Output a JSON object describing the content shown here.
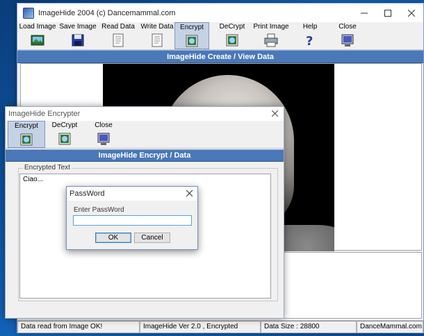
{
  "main_window": {
    "title": "ImageHide 2004 (c) Dancemammal.com",
    "toolbar": [
      {
        "label": "Load Image",
        "icon": "load-image-icon"
      },
      {
        "label": "Save Image",
        "icon": "save-image-icon"
      },
      {
        "label": "Read Data",
        "icon": "read-data-icon"
      },
      {
        "label": "Write Data",
        "icon": "write-data-icon"
      },
      {
        "label": "Encrypt",
        "icon": "encrypt-icon",
        "pressed": true
      },
      {
        "label": "DeCrypt",
        "icon": "decrypt-icon"
      },
      {
        "label": "Print Image",
        "icon": "print-icon"
      },
      {
        "label": "Help",
        "icon": "help-icon"
      },
      {
        "label": "Close",
        "icon": "close-icon"
      }
    ],
    "section_header": "ImageHide Create / View Data",
    "status": {
      "message": "Data read from Image OK!",
      "version": "ImageHide Ver 2.0 , Encrypted",
      "data_size": "Data Size : 28800",
      "site": "DanceMammal.com"
    }
  },
  "encrypter_window": {
    "title": "ImageHide Encrypter",
    "toolbar": [
      {
        "label": "Encrypt",
        "icon": "encrypt-icon",
        "pressed": true
      },
      {
        "label": "DeCrypt",
        "icon": "decrypt-icon"
      },
      {
        "label": "Close",
        "icon": "close-icon"
      }
    ],
    "section_header": "ImageHide Encrypt / Data",
    "groupbox_label": "Encrypted Text",
    "encrypted_text": "Ciao..."
  },
  "password_dialog": {
    "title": "PassWord",
    "prompt": "Enter PassWord",
    "value": "",
    "ok_label": "OK",
    "cancel_label": "Cancel"
  },
  "colors": {
    "header_blue": "#4a78b8",
    "pressed_bg": "#c5d2e6",
    "desktop": "#1262b8"
  }
}
